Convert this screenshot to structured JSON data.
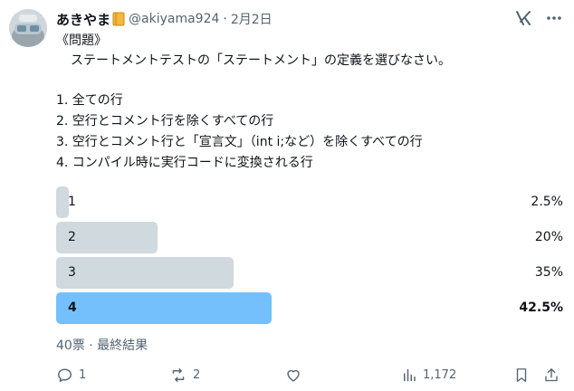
{
  "user": {
    "display_name": "あきやま",
    "handle": "@akiyama924",
    "separator": "·",
    "date": "2月2日",
    "avatar_icon": "avatar-image",
    "badge_icon": "notebook-emoji-icon"
  },
  "top_actions": {
    "logo_icon": "grok-icon",
    "more_icon": "more-icon"
  },
  "post": {
    "title": "《問題》",
    "question": "ステートメントテストの「ステートメント」の定義を選びなさい。",
    "options": [
      "1. 全ての行",
      "2. 空行とコメント行を除くすべての行",
      "3. 空行とコメント行と「宣言文」（int i;など）を除くすべての行",
      "4. コンパイル時に実行コードに変換される行"
    ]
  },
  "poll": {
    "choices": [
      {
        "label": "1",
        "percent_text": "2.5%",
        "percent": 2.5,
        "winner": false
      },
      {
        "label": "2",
        "percent_text": "20%",
        "percent": 20,
        "winner": false
      },
      {
        "label": "3",
        "percent_text": "35%",
        "percent": 35,
        "winner": false
      },
      {
        "label": "4",
        "percent_text": "42.5%",
        "percent": 42.5,
        "winner": true
      }
    ],
    "footer": "40票 · 最終結果",
    "colors": {
      "bar": "#cfd9de",
      "winner_bar": "#74c0fc"
    }
  },
  "actions": {
    "reply_count": "1",
    "repost_count": "2",
    "views_count": "1,172",
    "icons": [
      "reply-icon",
      "repost-icon",
      "like-icon",
      "views-icon",
      "bookmark-icon",
      "share-icon"
    ]
  }
}
